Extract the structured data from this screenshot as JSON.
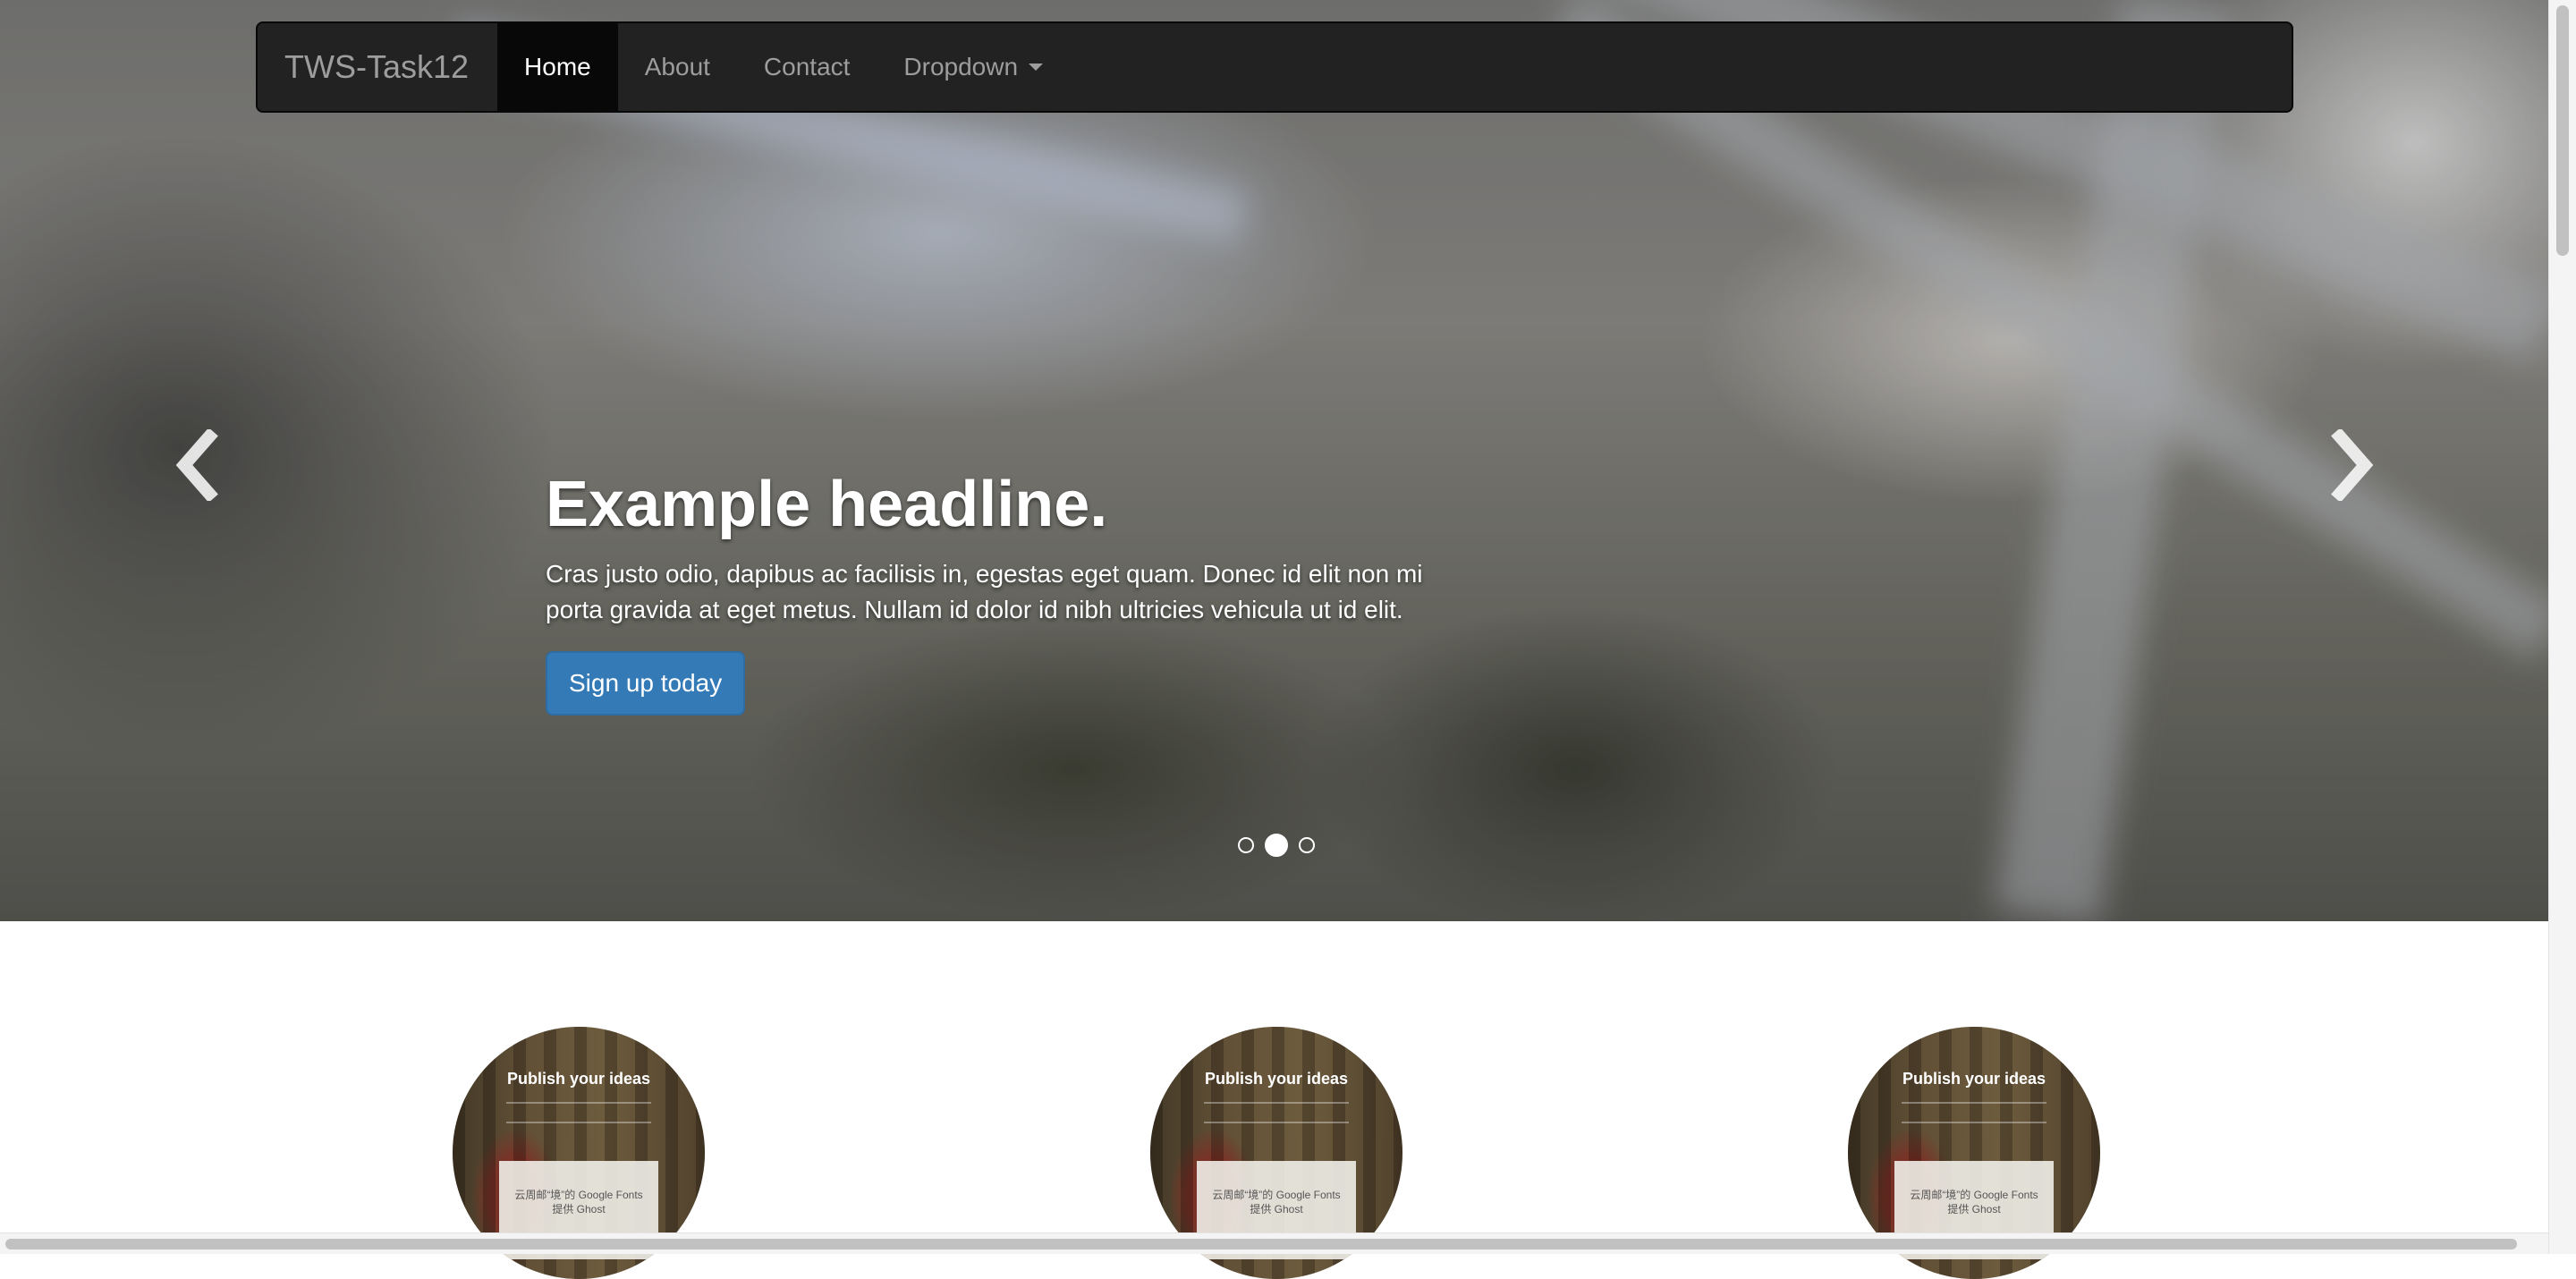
{
  "navbar": {
    "brand": "TWS-Task12",
    "items": [
      {
        "label": "Home",
        "active": true
      },
      {
        "label": "About",
        "active": false
      },
      {
        "label": "Contact",
        "active": false
      },
      {
        "label": "Dropdown",
        "active": false,
        "has_caret": true
      }
    ]
  },
  "carousel": {
    "headline": "Example headline.",
    "body": "Cras justo odio, dapibus ac facilisis in, egestas eget quam. Donec id elit non mi porta gravida at eget metus. Nullam id dolor id nibh ultricies vehicula ut id elit.",
    "cta_label": "Sign up today",
    "prev_icon": "chevron-left-icon",
    "next_icon": "chevron-right-icon",
    "slide_count": 3,
    "active_slide": 2
  },
  "marketing": {
    "items": [
      {
        "image_headline": "Publish your ideas",
        "image_caption": "云周邮“境”的 Google Fonts\n提供 Ghost"
      },
      {
        "image_headline": "Publish your ideas",
        "image_caption": "云周邮“境”的 Google Fonts\n提供 Ghost"
      },
      {
        "image_headline": "Publish your ideas",
        "image_caption": "云周邮“境”的 Google Fonts\n提供 Ghost"
      }
    ]
  },
  "colors": {
    "navbar_bg": "#222222",
    "navbar_active": "#080808",
    "nav_text": "#9d9d9d",
    "primary_button": "#337ab7"
  }
}
